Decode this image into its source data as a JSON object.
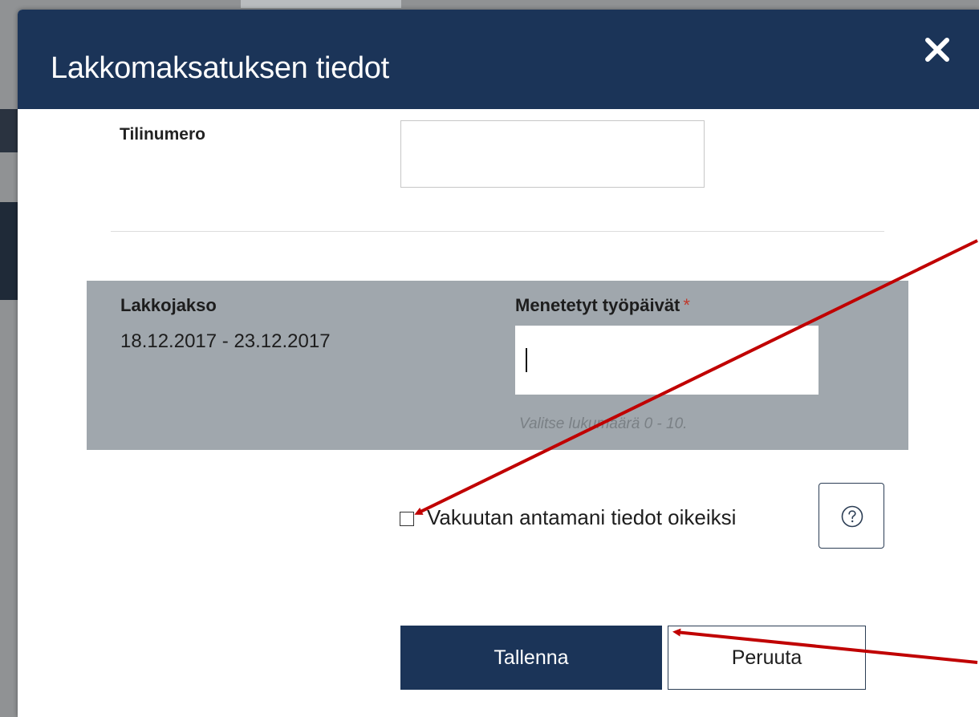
{
  "dialog": {
    "title": "Lakkomaksatuksen tiedot",
    "close_icon": "close-icon"
  },
  "account": {
    "label": "Tilinumero",
    "value": ""
  },
  "strike": {
    "period_label": "Lakkojakso",
    "period_value": "18.12.2017 - 23.12.2017",
    "days_label": "Menetetyt työpäivät",
    "required_marker": "*",
    "days_value": "",
    "days_hint": "Valitse lukumäärä 0 - 10."
  },
  "confirm": {
    "label": "Vakuutan antamani tiedot oikeiksi",
    "checked": false,
    "help_icon": "help-icon"
  },
  "actions": {
    "save_label": "Tallenna",
    "cancel_label": "Peruuta"
  },
  "colors": {
    "header_bg": "#1b3458",
    "panel_bg": "#a0a7ad",
    "annotation_arrow": "#c00000",
    "required": "#c0392b"
  }
}
